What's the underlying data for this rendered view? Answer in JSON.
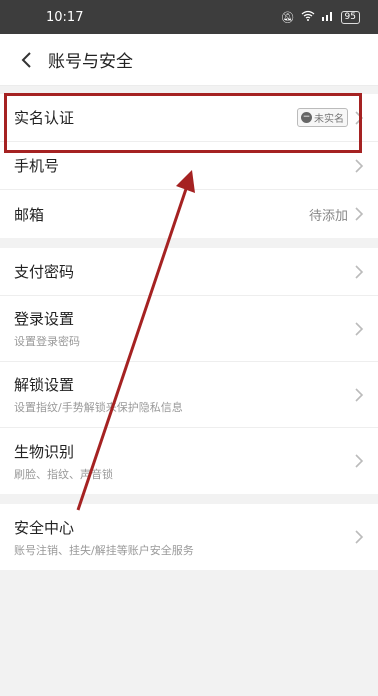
{
  "status_bar": {
    "time": "10:17",
    "battery": "95"
  },
  "nav": {
    "title": "账号与安全"
  },
  "groups": [
    [
      {
        "title": "实名认证",
        "badge": "未实名"
      },
      {
        "title": "手机号"
      },
      {
        "title": "邮箱",
        "value": "待添加"
      }
    ],
    [
      {
        "title": "支付密码"
      },
      {
        "title": "登录设置",
        "subtitle": "设置登录密码"
      },
      {
        "title": "解锁设置",
        "subtitle": "设置指纹/手势解锁来保护隐私信息"
      },
      {
        "title": "生物识别",
        "subtitle": "刷脸、指纹、声音锁"
      }
    ],
    [
      {
        "title": "安全中心",
        "subtitle": "账号注销、挂失/解挂等账户安全服务"
      }
    ]
  ],
  "colors": {
    "annotation": "#a52222",
    "status_bg": "#3d3d3d"
  },
  "icons": [
    "back-arrow-icon",
    "mute-icon",
    "wifi-icon",
    "signal-icon",
    "chevron-right-icon"
  ]
}
